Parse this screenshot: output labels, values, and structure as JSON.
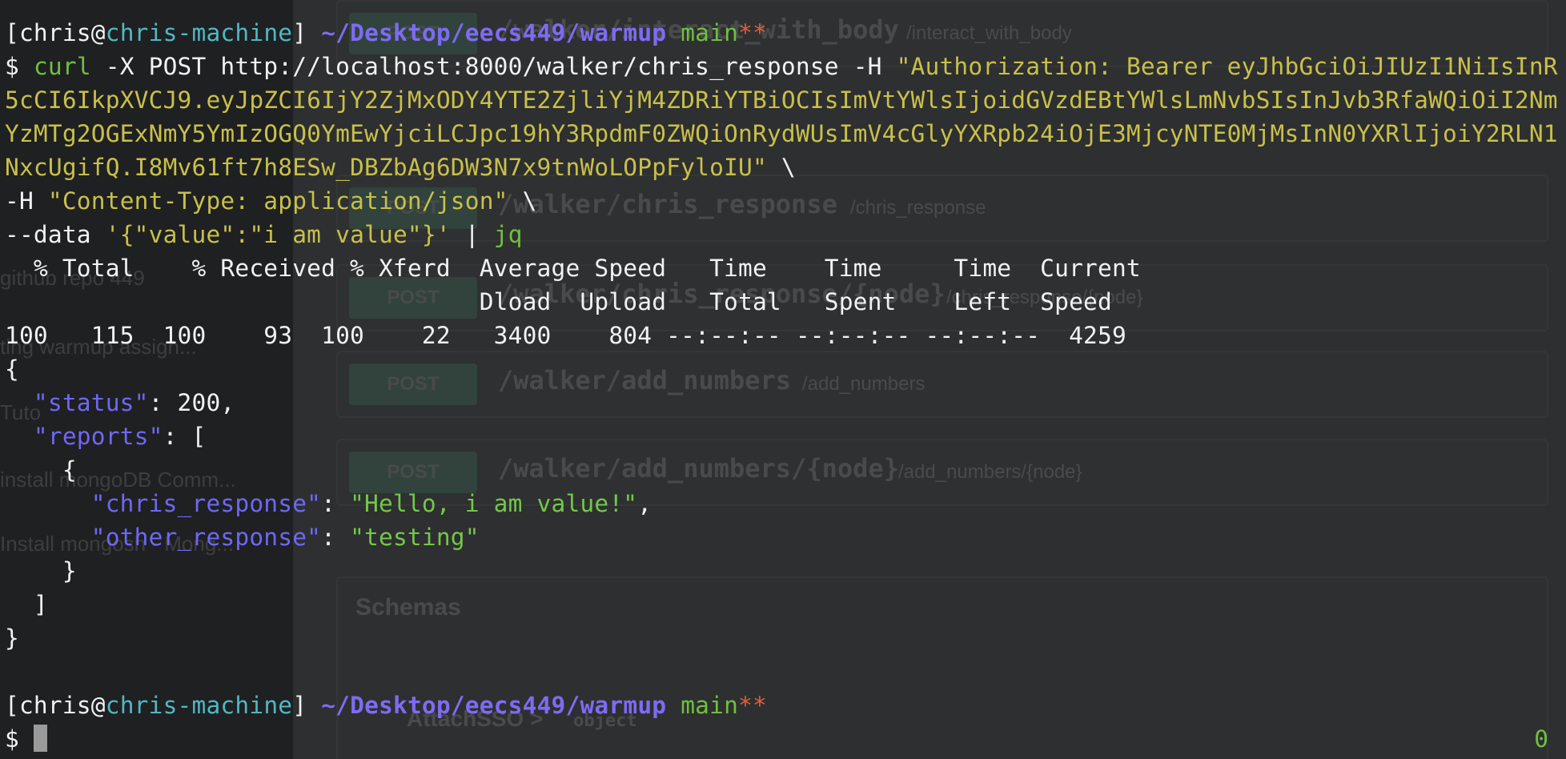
{
  "background_window": {
    "sidebar_items": [
      "github repo 449",
      "ting warmup assign...",
      "Tuto",
      "install mongoDB Comm...",
      "Install mongosh - Mong..."
    ],
    "endpoints": [
      {
        "method": "POST",
        "path": "/walker/interact_with_body",
        "desc": "/interact_with_body"
      },
      {
        "method": "POST",
        "path": "/walker/chris_response",
        "desc": "/chris_response"
      },
      {
        "method": "POST",
        "path": "/walker/chris_response/{node}",
        "desc": "/chris_response/{node}"
      },
      {
        "method": "POST",
        "path": "/walker/add_numbers",
        "desc": "/add_numbers"
      },
      {
        "method": "POST",
        "path": "/walker/add_numbers/{node}",
        "desc": "/add_numbers/{node}"
      }
    ],
    "schemas_title": "Schemas",
    "schema_item": "AttachSSO >",
    "schema_item_type": "object"
  },
  "prompt": {
    "user": "chris",
    "host": "chris-machine",
    "path": "~/Desktop/eecs449/warmup",
    "branch": "main",
    "dirty": "**",
    "symbol": "$"
  },
  "command": {
    "line1": "curl -X POST http://localhost:8000/walker/chris_response -H \"Authorization: Bearer eyJhbGciOiJIUzI1NiIsInR",
    "line2": "5cCI6IkpXVCJ9.eyJpZCI6IjY2ZjMxODY4YTE2ZjliYjM4ZDRiYTBiOCIsImVtYWlsIjoidGVzdEBtYWlsLmNvbSIsInJvb3RfaWQiOiI2Nm",
    "line3": "YzMTg2OGExNmY5YmIzOGQ0YmEwYjciLCJpc19hY3RpdmF0ZWQiOnRydWUsImV4cGlyYXRpb24iOjE3MjcyNTE0MjMsInN0YXRlIjoiY2RLN1",
    "line4": "NxcUgifQ.I8Mv61ft7h8ESw_DBZbAg6DW3N7x9tnWoLOPpFyloIU\"",
    "line5": "-H \"Content-Type: application/json\"",
    "line6_prefix": "--data ",
    "line6_data": "'{\"value\":\"i am value\"}'",
    "pipe": "|",
    "jq": "jq",
    "continuation": "\\"
  },
  "curl_progress": {
    "header1": "  % Total    % Received % Xferd  Average Speed   Time    Time     Time  Current",
    "header2": "                                 Dload  Upload   Total   Spent    Left  Speed",
    "row": "100   115  100    93  100    22   3400    804 --:--:-- --:--:-- --:--:--  4259"
  },
  "json_output": {
    "status_key": "\"status\"",
    "status_value": "200",
    "reports_key": "\"reports\"",
    "chris_response_key": "\"chris_response\"",
    "chris_response_value": "\"Hello, i am value!\"",
    "other_response_key": "\"other_response\"",
    "other_response_value": "\"testing\""
  },
  "exit_code": "0",
  "colors": {
    "background": "#232425",
    "prompt_host": "#4fb8c4",
    "prompt_path": "#7c6cf2",
    "branch": "#6fc040",
    "dirty_marker": "#e05f3a",
    "string": "#c8c04a",
    "json_key": "#6f67f6",
    "json_string": "#72c84a"
  }
}
